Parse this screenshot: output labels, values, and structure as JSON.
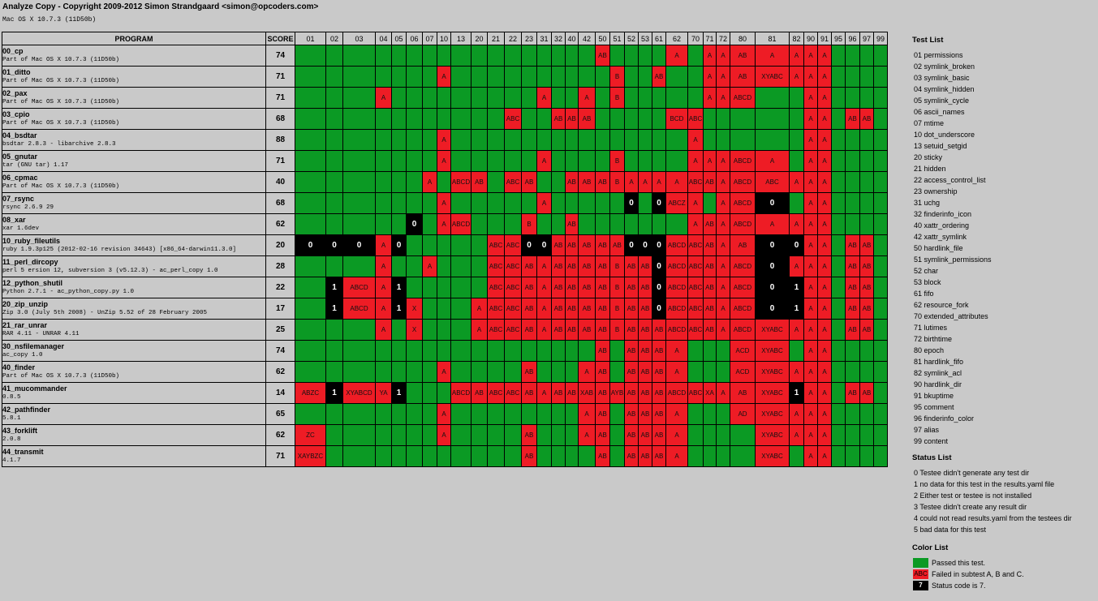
{
  "header": {
    "title": "Analyze Copy - Copyright 2009-2012 Simon Strandgaard <simon@opcoders.com>",
    "subtitle": "Mac OS X 10.7.3 (11D50b)"
  },
  "table": {
    "program_header": "PROGRAM",
    "score_header": "SCORE",
    "columns": [
      "01",
      "02",
      "03",
      "04",
      "05",
      "06",
      "07",
      "10",
      "13",
      "20",
      "21",
      "22",
      "23",
      "31",
      "32",
      "40",
      "42",
      "50",
      "51",
      "52",
      "53",
      "61",
      "62",
      "70",
      "71",
      "72",
      "80",
      "81",
      "82",
      "90",
      "91",
      "95",
      "96",
      "97",
      "99"
    ],
    "rows": [
      {
        "name": "00_cp",
        "version": "Part of Mac OS X 10.7.3 (11D50b)",
        "score": "74",
        "cells": [
          "",
          "",
          "",
          "",
          "",
          "",
          "",
          "",
          "",
          "",
          "",
          "",
          "",
          "",
          "",
          "",
          "",
          "AB",
          "",
          "",
          "",
          "",
          "A",
          "",
          "A",
          "A",
          "AB",
          "A",
          "A",
          "A",
          "A",
          "",
          "",
          "",
          ""
        ]
      },
      {
        "name": "01_ditto",
        "version": "Part of Mac OS X 10.7.3 (11D50b)",
        "score": "71",
        "cells": [
          "",
          "",
          "",
          "",
          "",
          "",
          "",
          "A",
          "",
          "",
          "",
          "",
          "",
          "",
          "",
          "",
          "",
          "",
          "B",
          "",
          "",
          "AB",
          "",
          "",
          "A",
          "A",
          "AB",
          "XYABC",
          "A",
          "A",
          "A",
          "",
          "",
          "",
          ""
        ]
      },
      {
        "name": "02_pax",
        "version": "Part of Mac OS X 10.7.3 (11D50b)",
        "score": "71",
        "cells": [
          "",
          "",
          "",
          "A",
          "",
          "",
          "",
          "",
          "",
          "",
          "",
          "",
          "",
          "A",
          "",
          "",
          "A",
          "",
          "B",
          "",
          "",
          "",
          "",
          "",
          "A",
          "A",
          "ABCD",
          "",
          "",
          "A",
          "A",
          "",
          "",
          "",
          ""
        ]
      },
      {
        "name": "03_cpio",
        "version": "Part of Mac OS X 10.7.3 (11D50b)",
        "score": "68",
        "cells": [
          "",
          "",
          "",
          "",
          "",
          "",
          "",
          "",
          "",
          "",
          "",
          "ABC",
          "",
          "",
          "AB",
          "AB",
          "AB",
          "",
          "",
          "",
          "",
          "",
          "BCD",
          "ABC",
          "",
          "",
          "",
          "",
          "",
          "A",
          "A",
          "",
          "AB",
          "AB",
          ""
        ]
      },
      {
        "name": "04_bsdtar",
        "version": "bsdtar 2.8.3 - libarchive 2.8.3",
        "score": "88",
        "cells": [
          "",
          "",
          "",
          "",
          "",
          "",
          "",
          "A",
          "",
          "",
          "",
          "",
          "",
          "",
          "",
          "",
          "",
          "",
          "",
          "",
          "",
          "",
          "",
          "A",
          "",
          "",
          "",
          "",
          "",
          "A",
          "A",
          "",
          "",
          "",
          ""
        ]
      },
      {
        "name": "05_gnutar",
        "version": "tar (GNU tar) 1.17",
        "score": "71",
        "cells": [
          "",
          "",
          "",
          "",
          "",
          "",
          "",
          "A",
          "",
          "",
          "",
          "",
          "",
          "A",
          "",
          "",
          "",
          "",
          "B",
          "",
          "",
          "",
          "",
          "A",
          "A",
          "A",
          "ABCD",
          "A",
          "",
          "A",
          "A",
          "",
          "",
          "",
          ""
        ]
      },
      {
        "name": "06_cpmac",
        "version": "Part of Mac OS X 10.7.3 (11D50b)",
        "score": "40",
        "cells": [
          "",
          "",
          "",
          "",
          "",
          "",
          "A",
          "",
          "ABCD",
          "AB",
          "",
          "ABC",
          "AB",
          "",
          "",
          "AB",
          "AB",
          "AB",
          "B",
          "A",
          "A",
          "A",
          "A",
          "ABC",
          "AB",
          "A",
          "ABCD",
          "ABC",
          "A",
          "A",
          "A",
          "",
          "",
          "",
          ""
        ]
      },
      {
        "name": "07_rsync",
        "version": "rsync  2.6.9   29",
        "score": "68",
        "cells": [
          "",
          "",
          "",
          "",
          "",
          "",
          "",
          "A",
          "",
          "",
          "",
          "",
          "",
          "A",
          "",
          "",
          "",
          "",
          "",
          "0",
          "",
          "0",
          "ABCZ",
          "A",
          "",
          "A",
          "ABCD",
          "0",
          "",
          "A",
          "A",
          "",
          "",
          "",
          ""
        ]
      },
      {
        "name": "08_xar",
        "version": "xar 1.6dev",
        "score": "62",
        "cells": [
          "",
          "",
          "",
          "",
          "",
          "0",
          "",
          "A",
          "ABCD",
          "",
          "",
          "",
          "B",
          "",
          "",
          "AB",
          "",
          "",
          "",
          "",
          "",
          "",
          "",
          "A",
          "AB",
          "A",
          "ABCD",
          "A",
          "A",
          "A",
          "A",
          "",
          "",
          "",
          ""
        ]
      },
      {
        "name": "10_ruby_fileutils",
        "version": "ruby 1.9.3p125 (2012-02-16 revision 34643) [x86_64-darwin11.3.0]",
        "score": "20",
        "cells": [
          "0",
          "0",
          "0",
          "A",
          "0",
          "",
          "",
          "",
          "",
          "",
          "ABC",
          "ABC",
          "0",
          "0",
          "AB",
          "AB",
          "AB",
          "AB",
          "AB",
          "0",
          "0",
          "0",
          "ABCD",
          "ABC",
          "AB",
          "A",
          "AB",
          "0",
          "0",
          "A",
          "A",
          "",
          "AB",
          "AB",
          ""
        ]
      },
      {
        "name": "11_perl_dircopy",
        "version": "perl 5 ersion 12, subversion 3 (v5.12.3) - ac_perl_copy 1.0",
        "score": "28",
        "cells": [
          "",
          "",
          "",
          "A",
          "",
          "",
          "A",
          "",
          "",
          "",
          "ABC",
          "ABC",
          "AB",
          "A",
          "AB",
          "AB",
          "AB",
          "AB",
          "B",
          "AB",
          "AB",
          "0",
          "ABCD",
          "ABC",
          "AB",
          "A",
          "ABCD",
          "0",
          "A",
          "A",
          "A",
          "",
          "AB",
          "AB",
          ""
        ]
      },
      {
        "name": "12_python_shutil",
        "version": "Python 2.7.1 - ac_python_copy.py 1.0",
        "score": "22",
        "cells": [
          "",
          "1",
          "ABCD",
          "A",
          "1",
          "",
          "",
          "",
          "",
          "",
          "ABC",
          "ABC",
          "AB",
          "A",
          "AB",
          "AB",
          "AB",
          "AB",
          "B",
          "AB",
          "AB",
          "0",
          "ABCD",
          "ABC",
          "AB",
          "A",
          "ABCD",
          "0",
          "1",
          "A",
          "A",
          "",
          "AB",
          "AB",
          ""
        ]
      },
      {
        "name": "20_zip_unzip",
        "version": "Zip 3.0 (July 5th 2008) - UnZip 5.52 of 28 February 2005",
        "score": "17",
        "cells": [
          "",
          "1",
          "ABCD",
          "A",
          "1",
          "X",
          "",
          "",
          "",
          "A",
          "ABC",
          "ABC",
          "AB",
          "A",
          "AB",
          "AB",
          "AB",
          "AB",
          "B",
          "AB",
          "AB",
          "0",
          "ABCD",
          "ABC",
          "AB",
          "A",
          "ABCD",
          "0",
          "1",
          "A",
          "A",
          "",
          "AB",
          "AB",
          ""
        ]
      },
      {
        "name": "21_rar_unrar",
        "version": "RAR 4.11 - UNRAR 4.11",
        "score": "25",
        "cells": [
          "",
          "",
          "",
          "A",
          "",
          "X",
          "",
          "",
          "",
          "A",
          "ABC",
          "ABC",
          "AB",
          "A",
          "AB",
          "AB",
          "AB",
          "AB",
          "B",
          "AB",
          "AB",
          "AB",
          "ABCD",
          "ABC",
          "AB",
          "A",
          "ABCD",
          "XYABC",
          "A",
          "A",
          "A",
          "",
          "AB",
          "AB",
          ""
        ]
      },
      {
        "name": "30_nsfilemanager",
        "version": "ac_copy 1.0",
        "score": "74",
        "cells": [
          "",
          "",
          "",
          "",
          "",
          "",
          "",
          "",
          "",
          "",
          "",
          "",
          "",
          "",
          "",
          "",
          "",
          "AB",
          "",
          "AB",
          "AB",
          "AB",
          "A",
          "",
          "",
          "",
          "ACD",
          "XYABC",
          "",
          "A",
          "A",
          "",
          "",
          "",
          ""
        ]
      },
      {
        "name": "40_finder",
        "version": "Part of Mac OS X 10.7.3 (11D50b)",
        "score": "62",
        "cells": [
          "",
          "",
          "",
          "",
          "",
          "",
          "",
          "A",
          "",
          "",
          "",
          "",
          "AB",
          "",
          "",
          "",
          "A",
          "AB",
          "",
          "AB",
          "AB",
          "AB",
          "A",
          "",
          "",
          "",
          "ACD",
          "XYABC",
          "A",
          "A",
          "A",
          "",
          "",
          "",
          ""
        ]
      },
      {
        "name": "41_mucommander",
        "version": "0.8.5",
        "score": "14",
        "cells": [
          "ABZC",
          "1",
          "XYABCD",
          "YA",
          "1",
          "",
          "",
          "",
          "ABCD",
          "AB",
          "ABC",
          "ABC",
          "AB",
          "A",
          "AB",
          "AB",
          "XAB",
          "AB",
          "AYB",
          "AB",
          "AB",
          "AB",
          "ABCD",
          "ABC",
          "XA",
          "A",
          "AB",
          "XYABC",
          "1",
          "A",
          "A",
          "",
          "AB",
          "AB",
          ""
        ]
      },
      {
        "name": "42_pathfinder",
        "version": "5.8.1",
        "score": "65",
        "cells": [
          "",
          "",
          "",
          "",
          "",
          "",
          "",
          "A",
          "",
          "",
          "",
          "",
          "",
          "",
          "",
          "",
          "A",
          "AB",
          "",
          "AB",
          "AB",
          "AB",
          "A",
          "",
          "",
          "",
          "AD",
          "XYABC",
          "A",
          "A",
          "A",
          "",
          "",
          "",
          ""
        ]
      },
      {
        "name": "43_forklift",
        "version": "2.0.8",
        "score": "62",
        "cells": [
          "ZC",
          "",
          "",
          "",
          "",
          "",
          "",
          "A",
          "",
          "",
          "",
          "",
          "AB",
          "",
          "",
          "",
          "A",
          "AB",
          "",
          "AB",
          "AB",
          "AB",
          "A",
          "",
          "",
          "",
          "",
          "XYABC",
          "A",
          "A",
          "A",
          "",
          "",
          "",
          ""
        ]
      },
      {
        "name": "44_transmit",
        "version": "4.1.7",
        "score": "71",
        "cells": [
          "XAYBZC",
          "",
          "",
          "",
          "",
          "",
          "",
          "",
          "",
          "",
          "",
          "",
          "AB",
          "",
          "",
          "",
          "",
          "AB",
          "",
          "AB",
          "AB",
          "AB",
          "A",
          "",
          "",
          "",
          "",
          "XYABC",
          "",
          "A",
          "A",
          "",
          "",
          "",
          ""
        ]
      }
    ]
  },
  "sidebar": {
    "test_list_title": "Test List",
    "tests": [
      "01 permissions",
      "02 symlink_broken",
      "03 symlink_basic",
      "04 symlink_hidden",
      "05 symlink_cycle",
      "06 ascii_names",
      "07 mtime",
      "10 dot_underscore",
      "13 setuid_setgid",
      "20 sticky",
      "21 hidden",
      "22 access_control_list",
      "23 ownership",
      "31 uchg",
      "32 finderinfo_icon",
      "40 xattr_ordering",
      "42 xattr_symlink",
      "50 hardlink_file",
      "51 symlink_permissions",
      "52 char",
      "53 block",
      "61 fifo",
      "62 resource_fork",
      "70 extended_attributes",
      "71 lutimes",
      "72 birthtime",
      "80 epoch",
      "81 hardlink_fifo",
      "82 symlink_acl",
      "90 hardlink_dir",
      "91 bkuptime",
      "95 comment",
      "96 finderinfo_color",
      "97 alias",
      "99 content"
    ],
    "status_list_title": "Status List",
    "statuses": [
      "0 Testee didn't generate any test dir",
      "1 no data for this test in the results.yaml file",
      "2 Either test or testee is not installed",
      "3 Testee didn't create any result dir",
      "4 could not read results.yaml from the testees dir",
      "5 bad data for this test"
    ],
    "color_list_title": "Color List",
    "colors": [
      {
        "swatch": "",
        "label": "Passed this test.",
        "kind": "pass",
        "color": "#0b9a24"
      },
      {
        "swatch": "ABC",
        "label": "Failed in subtest A, B and C.",
        "kind": "fail",
        "color": "#ee1c25"
      },
      {
        "swatch": "7",
        "label": "Status code is 7.",
        "kind": "status",
        "color": "#000000"
      }
    ]
  },
  "colors": {
    "pass": "#0b9a24",
    "fail": "#ee1c25",
    "status": "#000000",
    "background": "#c9c9c9"
  }
}
